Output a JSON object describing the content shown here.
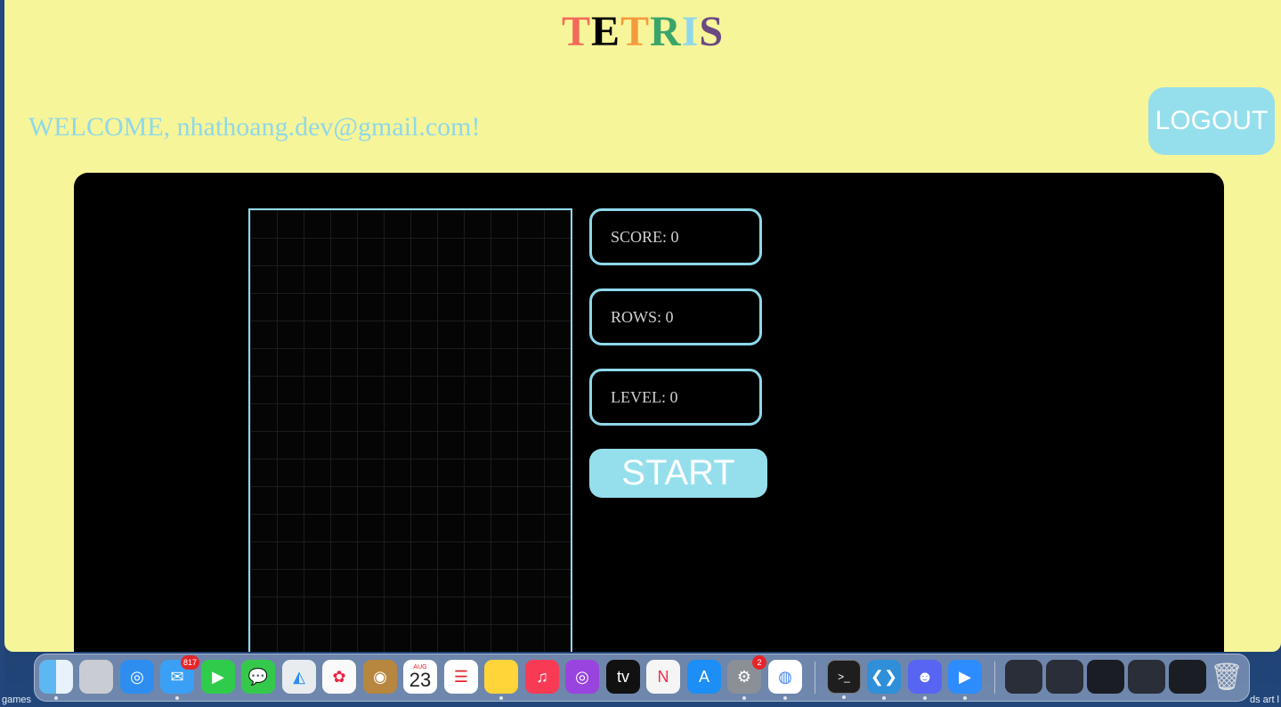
{
  "title": {
    "letters": [
      {
        "char": "T",
        "color": "#f26b5b"
      },
      {
        "char": "E",
        "color": "#000000"
      },
      {
        "char": "T",
        "color": "#f59a3c"
      },
      {
        "char": "R",
        "color": "#3aa56b"
      },
      {
        "char": "I",
        "color": "#8ed8ea"
      },
      {
        "char": "S",
        "color": "#6a4a80"
      }
    ]
  },
  "header": {
    "welcome": "WELCOME, nhathoang.dev@gmail.com!",
    "logout_label": "LOGOUT"
  },
  "stats": {
    "score": {
      "label": "SCORE:",
      "value": "0"
    },
    "rows": {
      "label": "ROWS:",
      "value": "0"
    },
    "level": {
      "label": "LEVEL:",
      "value": "0"
    }
  },
  "controls": {
    "start_label": "START"
  },
  "desktop": {
    "left_text": "games",
    "right_text": "ds art l"
  },
  "dock": {
    "mail_badge": "817",
    "calendar_month": "AUG",
    "calendar_day": "23",
    "settings_badge": "2"
  },
  "colors": {
    "page_bg": "#f7f599",
    "accent": "#8ed8ea",
    "button": "#95dfec",
    "game_bg": "#000000"
  }
}
